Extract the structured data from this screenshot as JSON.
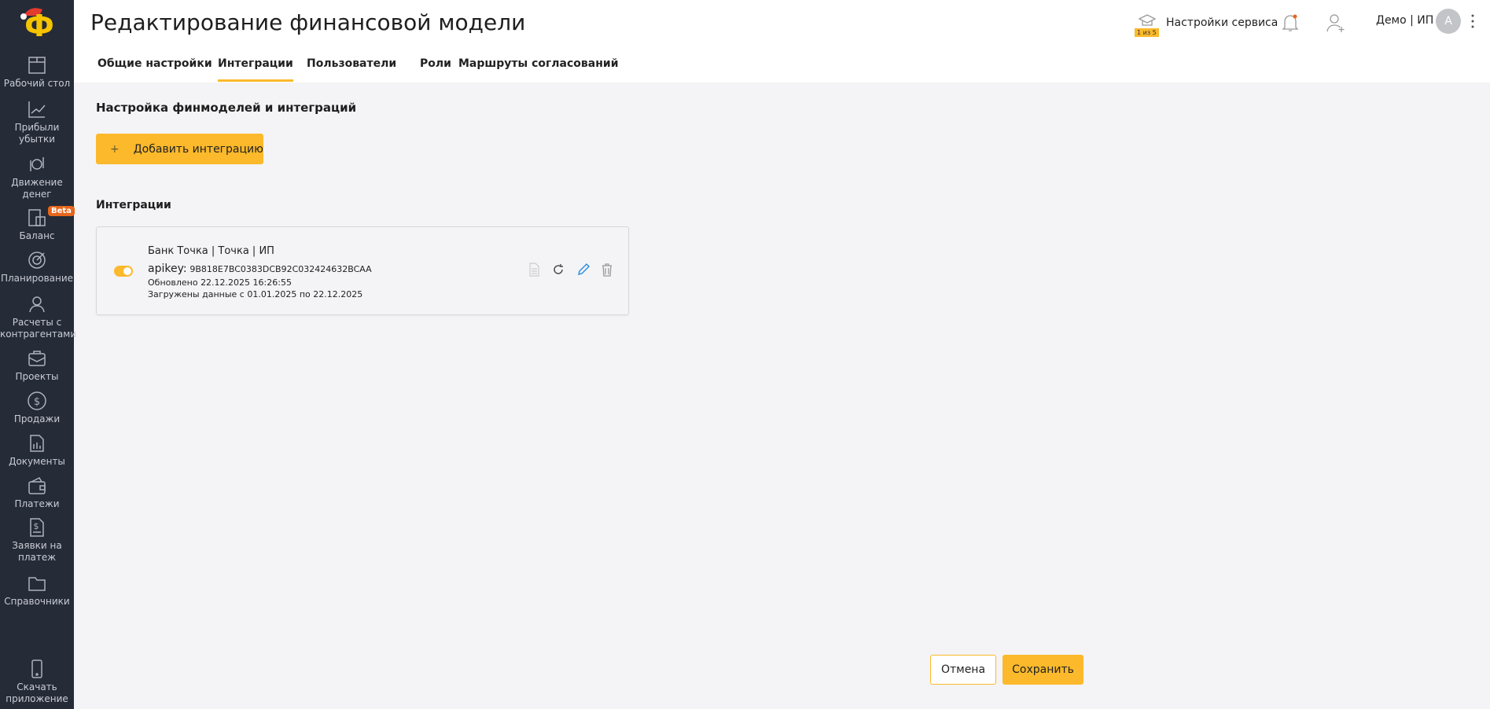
{
  "sidebar": {
    "items": [
      {
        "label": "Рабочий стол"
      },
      {
        "label": "Прибыли убытки"
      },
      {
        "label": "Движение денег"
      },
      {
        "label": "Баланс",
        "badge": "Beta"
      },
      {
        "label": "Планирование"
      },
      {
        "label": "Расчеты с контрагентами"
      },
      {
        "label": "Проекты"
      },
      {
        "label": "Продажи"
      },
      {
        "label": "Документы"
      },
      {
        "label": "Платежи"
      },
      {
        "label": "Заявки на платеж"
      },
      {
        "label": "Справочники"
      }
    ],
    "download": "Скачать приложение"
  },
  "header": {
    "title": "Редактирование финансовой модели",
    "service_settings": "Настройки сервиса",
    "onboarding_badge": "1 из 5",
    "account": "Демо | ИП",
    "avatar": "A"
  },
  "tabs": [
    {
      "label": "Общие настройки"
    },
    {
      "label": "Интеграции",
      "active": true
    },
    {
      "label": "Пользователи"
    },
    {
      "label": "Роли"
    },
    {
      "label": "Маршруты согласований"
    }
  ],
  "main": {
    "section_title": "Настройка финмоделей и интеграций",
    "add_button": "Добавить интеграцию",
    "add_icon": "+",
    "integrations_title": "Интеграции",
    "integrations": [
      {
        "name": "Банк Точка | Точка | ИП",
        "apikey_label": "apikey:",
        "apikey": "9B818E7BC0383DCB92C032424632BCAA",
        "updated": "Обновлено 22.12.2025 16:26:55",
        "loaded": "Загружены данные с 01.01.2025 по 22.12.2025",
        "enabled": true
      }
    ]
  },
  "footer": {
    "cancel": "Отмена",
    "save": "Сохранить"
  },
  "colors": {
    "accent": "#fbb92b",
    "sidebar": "#262b38",
    "beta": "#e8661c",
    "edit": "#2f8fe0"
  }
}
